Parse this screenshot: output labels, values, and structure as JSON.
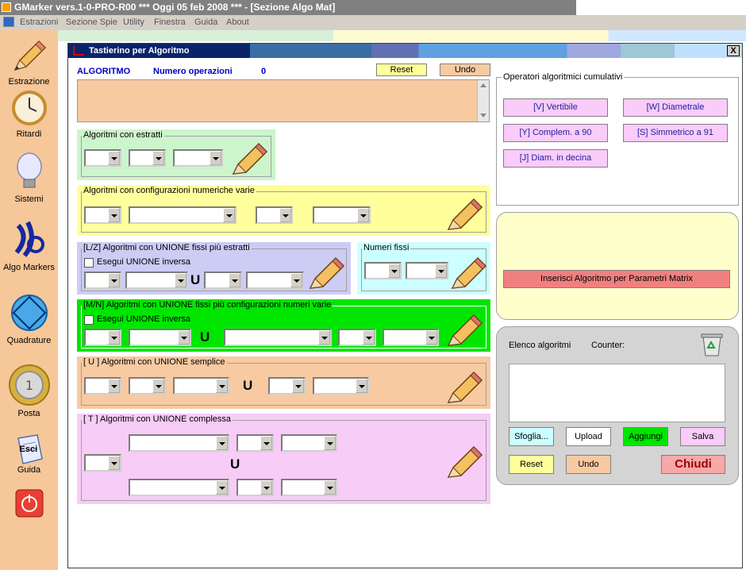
{
  "app": {
    "title": "GMarker vers.1-0-PRO-R00  ***  Oggi 05 feb 2008  ***   - [Sezione Algo Mat]",
    "menu": [
      "Estrazioni",
      "Sezione Spie",
      "Utility",
      "Finestra",
      "Guida",
      "About"
    ]
  },
  "sidebar": {
    "items": [
      {
        "label": "Estrazione",
        "icon": "pencil-icon"
      },
      {
        "label": "Ritardi",
        "icon": "clock-icon"
      },
      {
        "label": "Sistemi",
        "icon": "lightbulb-icon"
      },
      {
        "label": "Algo Markers",
        "icon": "lottery-logo-icon"
      },
      {
        "label": "Quadrature",
        "icon": "square-circle-icon"
      },
      {
        "label": "Posta",
        "icon": "euro-coin-icon"
      },
      {
        "label": "Guida",
        "icon": "guide-book-icon"
      },
      {
        "label": "",
        "icon": "power-icon"
      }
    ],
    "guide_overlay": "Esci"
  },
  "dialog": {
    "title": "Tastierino per Algoritmo",
    "close": "X",
    "algoritmo_label": "ALGORITMO",
    "num_op_label": "Numero operazioni",
    "num_op_value": "0",
    "reset_label": "Reset",
    "undo_label": "Undo",
    "groups": {
      "estratti": "Algoritmi con estratti",
      "config": "Algoritmi con configurazioni numeriche varie",
      "lz": "[L/Z] Algoritmi con UNIONE fissi più estratti",
      "numeri_fissi": "Numeri fissi",
      "mn": "[M/N] Algoritmi con UNIONE fissi più configurazioni numeri varie",
      "u": "[ U ] Algoritmi con UNIONE semplice",
      "t": "[ T ] Algoritmi con UNIONE complessa"
    },
    "esegui_unione": "Esegui UNIONE inversa",
    "union_glyph": "U",
    "operators": {
      "title": "Operatori algoritmici cumulativi",
      "buttons": [
        "[V] Vertibile",
        "[W] Diametrale",
        "[Y] Complem. a 90",
        "[S] Simmetrico  a 91",
        "[J] Diam. in decina"
      ]
    },
    "matrix_button": "Inserisci Algoritmo per Parametri Matrix",
    "elenco": {
      "label": "Elenco algoritmi",
      "counter": "Counter:",
      "buttons": {
        "sfoglia": "Sfoglia...",
        "upload": "Upload",
        "aggiungi": "Aggiungi",
        "salva": "Salva",
        "reset": "Reset",
        "undo": "Undo",
        "chiudi": "Chiudi"
      }
    }
  },
  "colors": {
    "sidebar": "#f6c799",
    "algo_box": "#f7caa2",
    "estratti": "#ccf5cc",
    "config": "#ffff9c",
    "lz": "#ccccf5",
    "numeri_fissi": "#ccffff",
    "mn": "#00e600",
    "u": "#f7caa2",
    "t": "#f7ccf7",
    "operator_btn": "#f9ccf9",
    "matrix_btn": "#f08080"
  }
}
